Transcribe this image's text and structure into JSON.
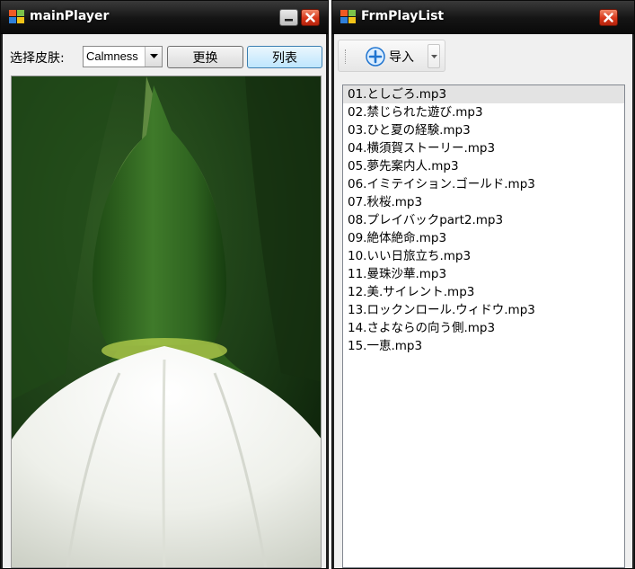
{
  "main_window": {
    "title": "mainPlayer",
    "skin_label": "选择皮肤:",
    "skin_combo_value": "Calmness",
    "change_button": "更换",
    "list_button": "列表"
  },
  "playlist_window": {
    "title": "FrmPlayList",
    "import_button": "导入",
    "items": [
      "01.としごろ.mp3",
      "02.禁じられた遊び.mp3",
      "03.ひと夏の経験.mp3",
      "04.横須賀ストーリー.mp3",
      "05.夢先案内人.mp3",
      "06.イミテイション.ゴールド.mp3",
      "07.秋桜.mp3",
      "08.プレイバックpart2.mp3",
      "09.絶体絶命.mp3",
      "10.いい日旅立ち.mp3",
      "11.曼珠沙華.mp3",
      "12.美.サイレント.mp3",
      "13.ロックンロール.ウィドウ.mp3",
      "14.さよならの向う側.mp3",
      "15.一恵.mp3"
    ],
    "selected_index": 0
  },
  "icons": {
    "app": "windows-logo-icon",
    "minimize": "minimize-icon",
    "close": "close-icon",
    "combo_arrow": "chevron-down-icon",
    "import": "plus-circle-icon",
    "dropdown": "chevron-down-icon"
  },
  "colors": {
    "titlebar": "#141414",
    "close_button": "#d8371a",
    "import_icon": "#1f74d0",
    "selected_row": "#e3e3e3"
  }
}
